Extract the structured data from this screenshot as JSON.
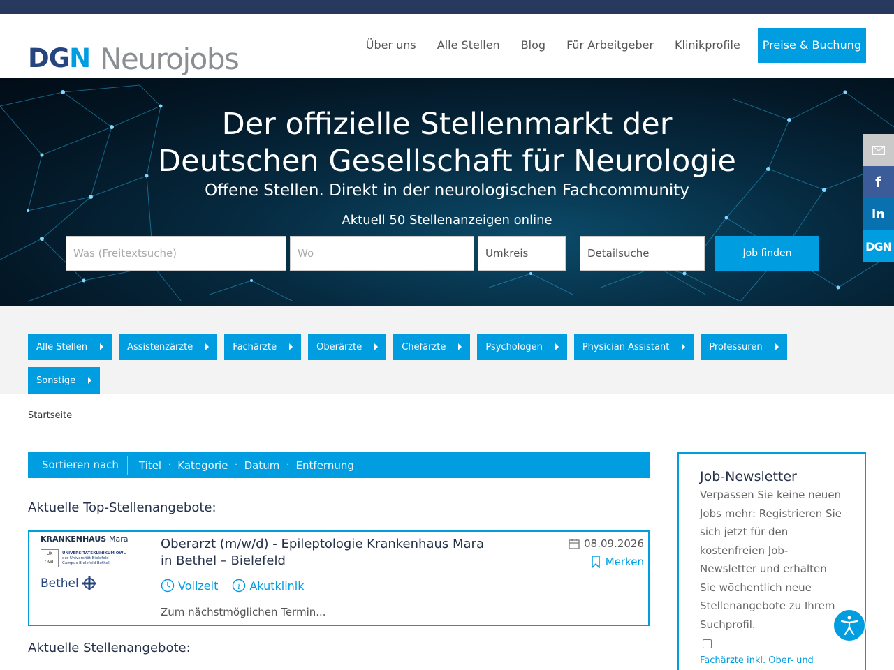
{
  "brand": {
    "logo_dgn": "DGN",
    "logo_name": "Neurojobs"
  },
  "nav": {
    "items": [
      "Über uns",
      "Alle Stellen",
      "Blog",
      "Für Arbeitgeber",
      "Klinikprofile"
    ],
    "cta": "Preise & Buchung"
  },
  "hero": {
    "title_line1": "Der offizielle Stellenmarkt der",
    "title_line2": "Deutschen Gesellschaft für Neurologie",
    "subtitle": "Offene Stellen. Direkt in der neurologischen Fachcommunity",
    "count": "Aktuell 50 Stellenanzeigen online"
  },
  "search": {
    "what_placeholder": "Was (Freitextsuche)",
    "where_placeholder": "Wo",
    "radius_label": "Umkreis",
    "detail_label": "Detailsuche",
    "submit": "Job finden"
  },
  "social": {
    "dgn_label": "DGN",
    "fb_label": "f",
    "in_label": "in"
  },
  "categories": [
    "Alle Stellen",
    "Assistenzärzte",
    "Fachärzte",
    "Oberärzte",
    "Chefärzte",
    "Psychologen",
    "Physician Assistant",
    "Professuren",
    "Sonstige"
  ],
  "breadcrumb": "Startseite",
  "sort": {
    "label": "Sortieren nach",
    "options": [
      "Titel",
      "Kategorie",
      "Datum",
      "Entfernung"
    ]
  },
  "top_jobs_heading": "Aktuelle Top-Stellenangebote:",
  "jobs_heading": "Aktuelle Stellenangebote:",
  "top_job": {
    "company_logo": {
      "name_bold": "KRANKENHAUS",
      "name_light": "Mara",
      "uk_box": "UK\nOWL",
      "uk_text_1": "UNIVERSITÄTSKLINIKUM OWL",
      "uk_text_2": "der Universität Bielefeld",
      "uk_text_3": "Campus Bielefeld-Bethel",
      "bethel": "Bethel"
    },
    "title": "Oberarzt (m/w/d) - Epileptologie Krankenhaus Mara in Bethel – Bielefeld",
    "date": "08.09.2026",
    "save_label": "Merken",
    "employment": "Vollzeit",
    "facility": "Akutklinik",
    "teaser": "Zum nächstmöglichen Termin..."
  },
  "newsletter": {
    "title": "Job-Newsletter",
    "text": "Verpassen Sie keine neuen Jobs mehr: Registrieren Sie sich jetzt für den kostenfreien Job-Newsletter und erhalten Sie wöchentlich neue Stellenangebote zu Ihrem Suchprofil.",
    "checkbox_label": "Fachärzte inkl. Ober- und"
  },
  "colors": {
    "primary": "#009ee0",
    "navy": "#273a5e",
    "text_dark": "#26324a"
  }
}
